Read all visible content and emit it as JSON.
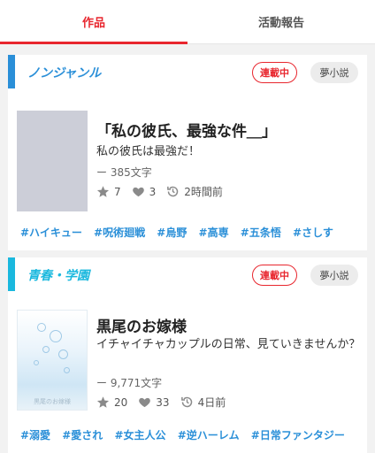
{
  "tabs": [
    {
      "label": "作品",
      "active": true
    },
    {
      "label": "活動報告",
      "active": false
    }
  ],
  "colors": {
    "accent": "#e8262e",
    "tag": "#2a8fd8",
    "genre1": "#2a8fd8",
    "genre2": "#1ab8de"
  },
  "works": [
    {
      "genre": "ノンジャンル",
      "status": "連載中",
      "type": "夢小説",
      "title": "「私の彼氏、最強な件＿」",
      "description": "私の彼氏は最強だ！",
      "char_count": "ー 385文字",
      "likes": "7",
      "hearts": "3",
      "updated": "2時間前",
      "cover_caption": "",
      "tags": [
        "#ハイキュー",
        "#呪術廻戦",
        "#烏野",
        "#高専",
        "#五条悟",
        "#さしす"
      ]
    },
    {
      "genre": "青春・学園",
      "status": "連載中",
      "type": "夢小説",
      "title": "黒尾のお嫁様",
      "description": "イチャイチャカップルの日常、見ていきませんか？",
      "char_count": "ー 9,771文字",
      "likes": "20",
      "hearts": "33",
      "updated": "4日前",
      "cover_caption": "黒尾のお嫁様",
      "tags": [
        "#溺愛",
        "#愛され",
        "#女主人公",
        "#逆ハーレム",
        "#日常ファンタジー"
      ]
    }
  ]
}
